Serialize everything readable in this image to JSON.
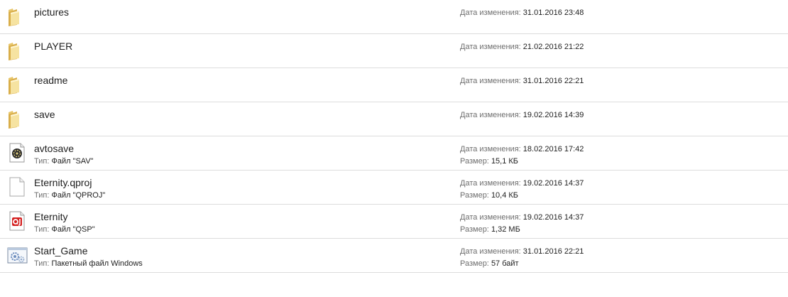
{
  "labels": {
    "date_label": "Дата изменения:",
    "type_label": "Тип:",
    "size_label": "Размер:"
  },
  "items": [
    {
      "name": "pictures",
      "icon": "folder-icon",
      "date": "31.01.2016 23:48"
    },
    {
      "name": "PLAYER",
      "icon": "folder-icon",
      "date": "21.02.2016 21:22"
    },
    {
      "name": "readme",
      "icon": "folder-icon",
      "date": "31.01.2016 22:21"
    },
    {
      "name": "save",
      "icon": "folder-icon",
      "date": "19.02.2016 14:39"
    },
    {
      "name": "avtosave",
      "icon": "sav-file-icon",
      "type": "Файл \"SAV\"",
      "date": "18.02.2016 17:42",
      "size": "15,1 КБ"
    },
    {
      "name": "Eternity.qproj",
      "icon": "blank-file-icon",
      "type": "Файл \"QPROJ\"",
      "date": "19.02.2016 14:37",
      "size": "10,4 КБ"
    },
    {
      "name": "Eternity",
      "icon": "qsp-file-icon",
      "type": "Файл \"QSP\"",
      "date": "19.02.2016 14:37",
      "size": "1,32 МБ"
    },
    {
      "name": "Start_Game",
      "icon": "batch-file-icon",
      "type": "Пакетный файл Windows",
      "date": "31.01.2016 22:21",
      "size": "57 байт"
    }
  ]
}
